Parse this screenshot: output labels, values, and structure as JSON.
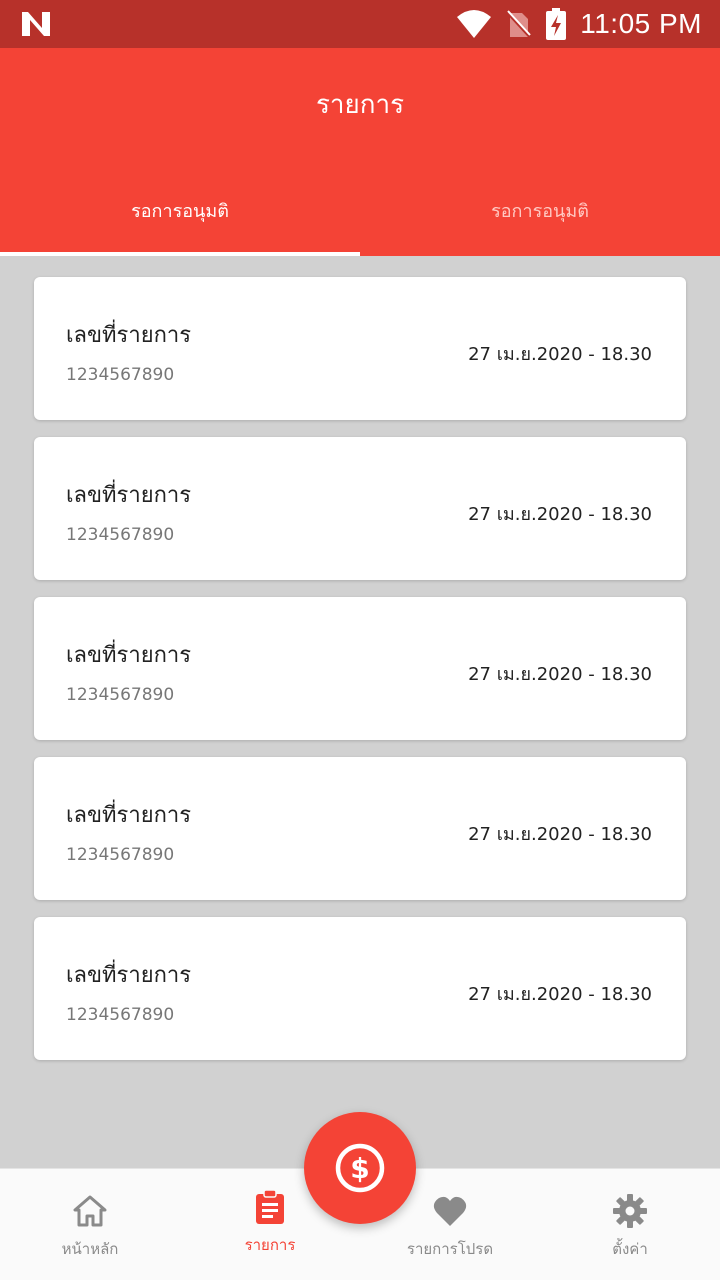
{
  "status_bar": {
    "time": "11:05 PM",
    "icons": [
      "n-logo-icon",
      "wifi-icon",
      "no-sim-icon",
      "battery-charging-icon"
    ]
  },
  "app_bar": {
    "title": "รายการ"
  },
  "tabs": [
    {
      "label": "รอการอนุมติ",
      "selected": true
    },
    {
      "label": "รอการอนุมติ",
      "selected": false
    }
  ],
  "items": [
    {
      "label": "เลขที่รายการ",
      "number": "1234567890",
      "date": "27  เม.ย.2020  -  18.30"
    },
    {
      "label": "เลขที่รายการ",
      "number": "1234567890",
      "date": "27  เม.ย.2020  -  18.30"
    },
    {
      "label": "เลขที่รายการ",
      "number": "1234567890",
      "date": "27  เม.ย.2020  -  18.30"
    },
    {
      "label": "เลขที่รายการ",
      "number": "1234567890",
      "date": "27  เม.ย.2020  -  18.30"
    },
    {
      "label": "เลขที่รายการ",
      "number": "1234567890",
      "date": "27  เม.ย.2020  -  18.30"
    }
  ],
  "fab": {
    "icon": "dollar-circle-icon"
  },
  "bottom_nav": [
    {
      "label": "หน้าหลัก",
      "icon": "home-icon",
      "active": false
    },
    {
      "label": "รายการ",
      "icon": "clipboard-list-icon",
      "active": true
    },
    {
      "label": "รายการโปรด",
      "icon": "heart-icon",
      "active": false
    },
    {
      "label": "ตั้งค่า",
      "icon": "gear-icon",
      "active": false
    }
  ],
  "colors": {
    "status_bar": "#b7312a",
    "primary": "#f44336",
    "background": "#d1d1d1",
    "inactive_nav": "#8a8a8a"
  }
}
